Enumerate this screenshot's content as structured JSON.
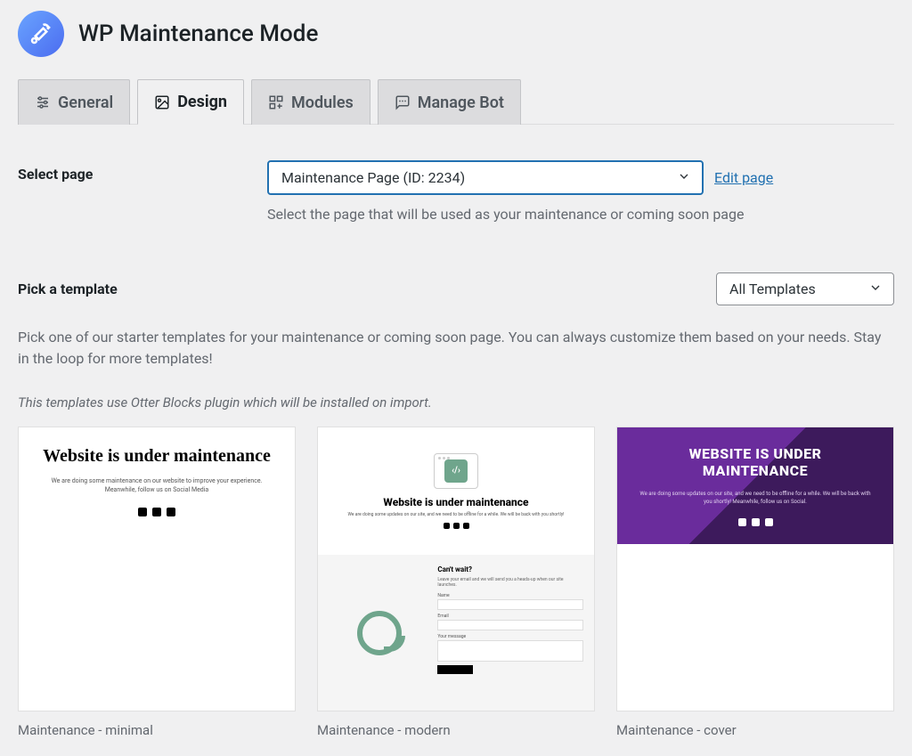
{
  "header": {
    "title": "WP Maintenance Mode"
  },
  "tabs": [
    {
      "label": "General"
    },
    {
      "label": "Design"
    },
    {
      "label": "Modules"
    },
    {
      "label": "Manage Bot"
    }
  ],
  "select_page": {
    "label": "Select page",
    "value": "Maintenance Page (ID: 2234)",
    "edit_link": "Edit page",
    "description": "Select the page that will be used as your maintenance or coming soon page"
  },
  "templates": {
    "label": "Pick a template",
    "filter_value": "All Templates",
    "description": "Pick one of our starter templates for your maintenance or coming soon page. You can always customize them based on your needs. Stay in the loop for more templates!",
    "note": "This templates use Otter Blocks plugin which will be installed on import.",
    "cards": [
      {
        "caption": "Maintenance - minimal",
        "thumb_title": "Website is under maintenance",
        "thumb_sub": "We are doing some maintenance on our website to improve your experience. Meanwhile, follow us on Social Media"
      },
      {
        "caption": "Maintenance - modern",
        "thumb_title": "Website is under maintenance",
        "thumb_sub": "We are doing some updates on our site, and we need to be offline for a while. We will be back with you shortly!",
        "form_title": "Can't wait?",
        "form_sub": "Leave your email and we will send you a heads-up when our site launches."
      },
      {
        "caption": "Maintenance - cover",
        "thumb_title": "WEBSITE IS UNDER MAINTENANCE",
        "thumb_sub": "We are doing some updates on our site, and we need to be offline for a while. We will be back with you shortly! Meanwhile, follow us on Social."
      }
    ]
  }
}
